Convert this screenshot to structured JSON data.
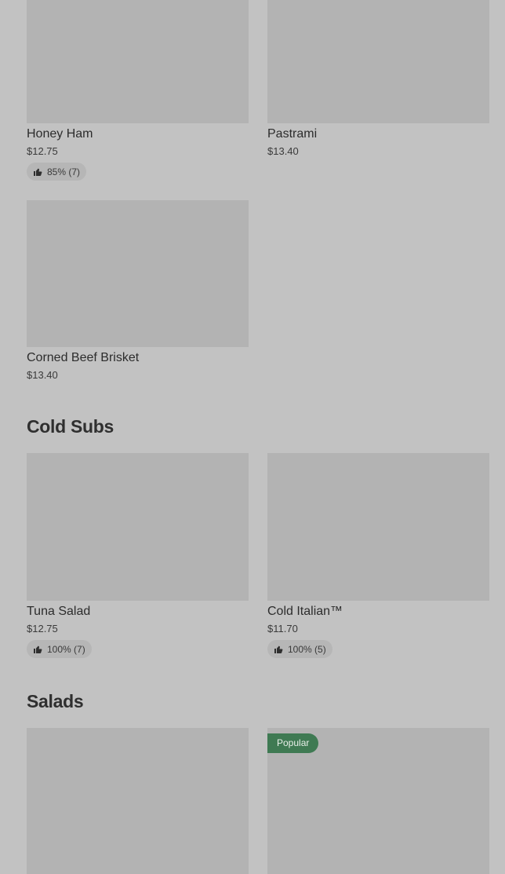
{
  "sections": {
    "cold_subs": {
      "title": "Cold Subs"
    },
    "salads": {
      "title": "Salads"
    }
  },
  "items": {
    "honey_ham": {
      "name": "Honey Ham",
      "price": "$12.75",
      "rating": "85% (7)"
    },
    "pastrami": {
      "name": "Pastrami",
      "price": "$13.40"
    },
    "corned_beef_brisket": {
      "name": "Corned Beef Brisket",
      "price": "$13.40"
    },
    "tuna_salad": {
      "name": "Tuna Salad",
      "price": "$12.75",
      "rating": "100% (7)"
    },
    "cold_italian": {
      "name": "Cold Italian™",
      "price": "$11.70",
      "rating": "100% (5)"
    },
    "salad_2": {
      "badge": "Popular"
    }
  },
  "colors": {
    "background": "#c2c2c2",
    "image_placeholder": "#b3b3b3",
    "rating_pill": "#b6b6b6",
    "popular_badge": "#3f7a53"
  },
  "icons": {
    "rating": "thumbs-up-icon"
  }
}
